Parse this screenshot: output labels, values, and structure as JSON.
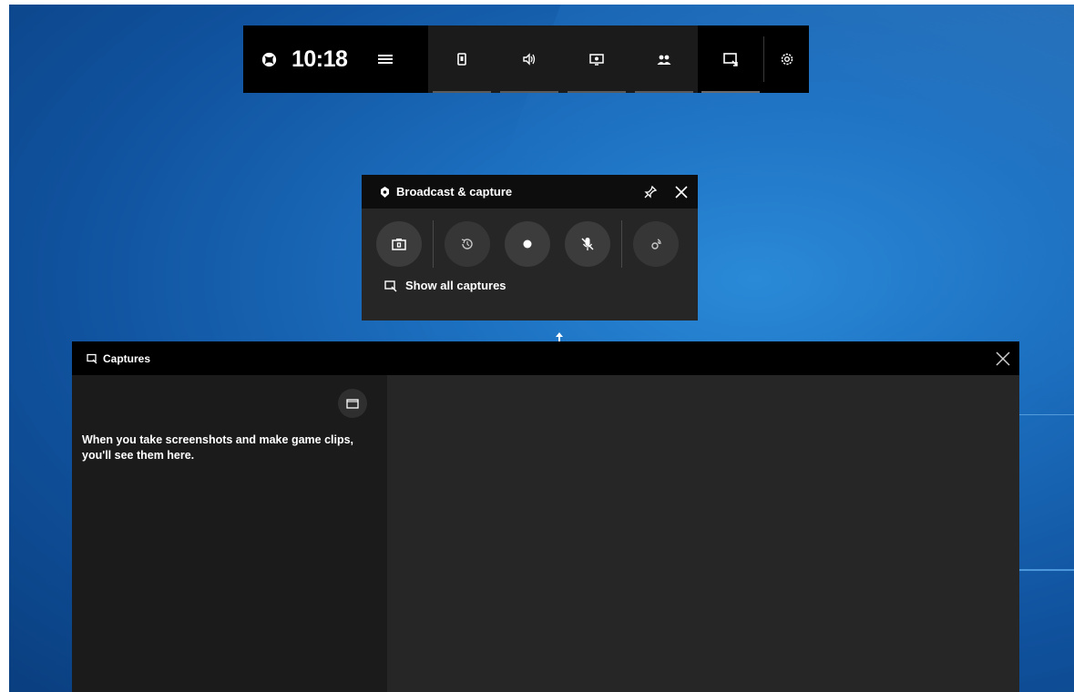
{
  "gamebar": {
    "time": "10:18",
    "icons": {
      "xbox": "xbox-logo-icon",
      "menu": "menu-icon",
      "widgets": [
        "audio-widget-icon",
        "performance-widget-icon",
        "capture-widget-icon",
        "xbox-social-icon"
      ],
      "captures": "captures-gallery-icon",
      "settings": "gear-icon"
    }
  },
  "broadcast": {
    "title": "Broadcast & capture",
    "buttons": [
      "screenshot-camera-icon",
      "record-last-30s-icon",
      "start-recording-icon",
      "mic-off-icon",
      "broadcast-icon"
    ],
    "show_all_label": "Show all captures"
  },
  "captures": {
    "title": "Captures",
    "empty_message": "When you take screenshots and make game clips, you'll see them here."
  },
  "colors": {
    "desktop_blue": "#1c6fbf",
    "panel_dark": "#262626",
    "header_black": "#000000"
  }
}
